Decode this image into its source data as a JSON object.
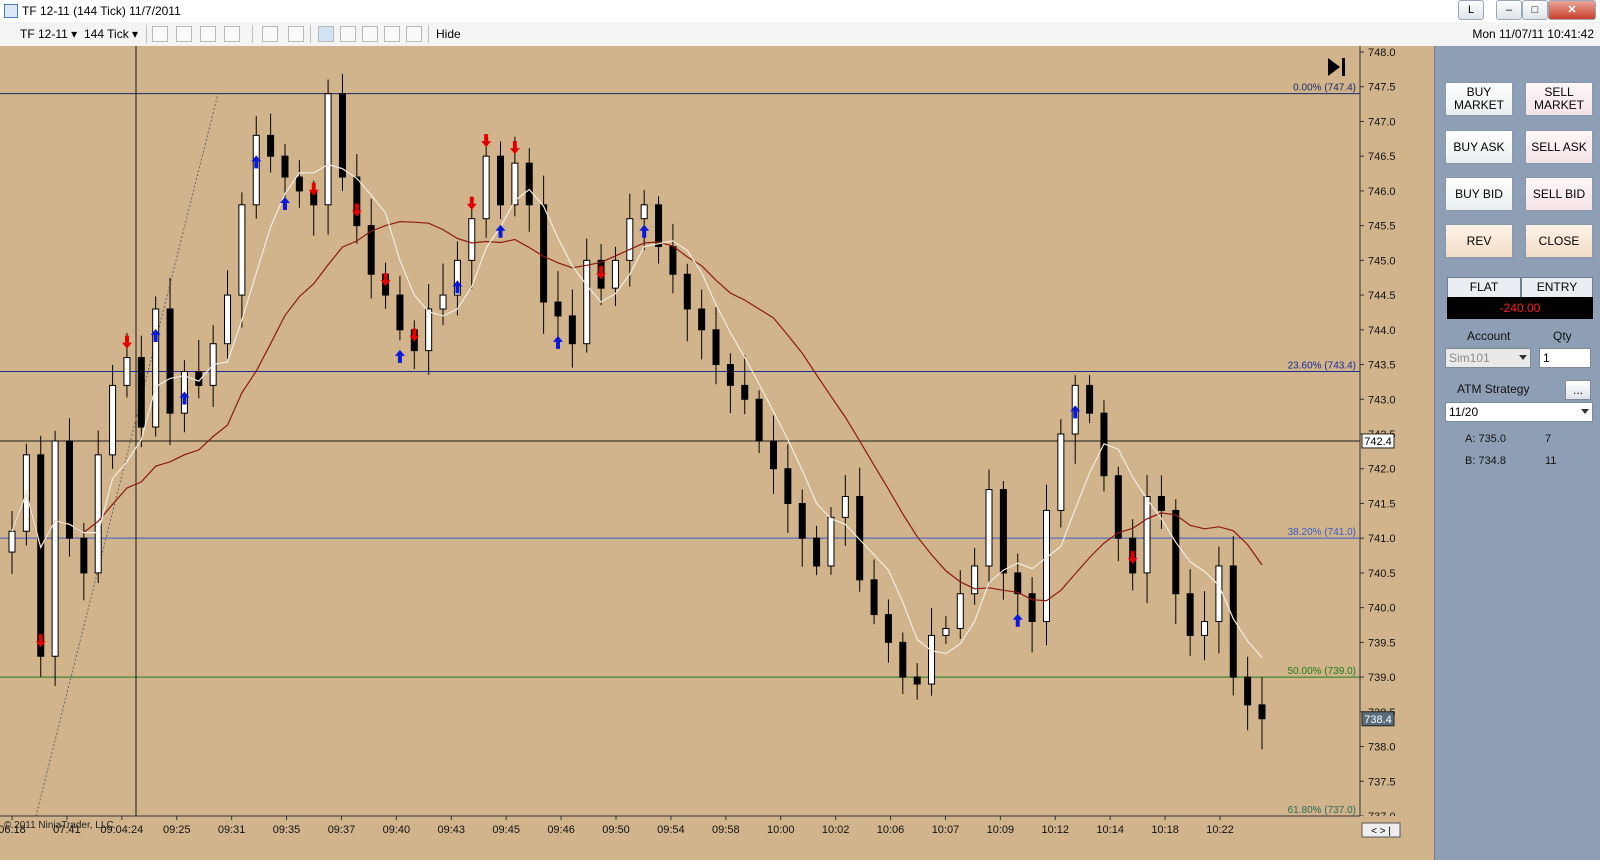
{
  "window": {
    "title": "TF 12-11 (144 Tick)  11/7/2011",
    "buttons": {
      "l": "L",
      "minimize": "–",
      "maximize": "□",
      "close": "✕"
    }
  },
  "toolbar": {
    "instrument": "TF 12-11",
    "interval": "144 Tick",
    "hide_label": "Hide",
    "datetime": "Mon 11/07/11 10:41:42",
    "icons": [
      "bar-type-icon",
      "draw-pencil-icon",
      "drawing-tools-icon",
      "strategy-icon",
      "crosshair-icon",
      "zoom-icon",
      "chart-trader-icon",
      "indicators-icon",
      "chart-properties-icon",
      "data-box-icon",
      "notes-icon"
    ]
  },
  "chart_data": {
    "type": "candlestick",
    "x_ticks": [
      "06:18",
      "07:41",
      "09:04:24",
      "09:25",
      "09:31",
      "09:35",
      "09:37",
      "09:40",
      "09:43",
      "09:45",
      "09:46",
      "09:50",
      "09:54",
      "09:58",
      "10:00",
      "10:02",
      "10:06",
      "10:07",
      "10:09",
      "10:12",
      "10:14",
      "10:18",
      "10:22"
    ],
    "y_ticks": [
      "748.0",
      "747.5",
      "747.0",
      "746.5",
      "746.0",
      "745.5",
      "745.0",
      "744.5",
      "744.0",
      "743.5",
      "743.0",
      "742.5",
      "742.0",
      "741.5",
      "741.0",
      "740.5",
      "740.0",
      "739.5",
      "739.0",
      "738.5",
      "738.0",
      "737.5",
      "737.0"
    ],
    "ylim": [
      737.0,
      748.0
    ],
    "last_price": "742.4",
    "current_price": "738.4",
    "fib_levels": [
      {
        "label": "0.00% (747.4)",
        "price": 747.4,
        "color": "#1a2a66"
      },
      {
        "label": "23.60% (743.4)",
        "price": 743.4,
        "color": "#1a2a99"
      },
      {
        "label": "38.20% (741.0)",
        "price": 741.0,
        "color": "#3a5ac8"
      },
      {
        "label": "50.00% (739.0)",
        "price": 739.0,
        "color": "#1d7a1d"
      },
      {
        "label": "61.80% (737.0)",
        "price": 737.0,
        "color": "#2a6a55"
      }
    ],
    "close_series": [
      741.1,
      742.2,
      739.3,
      742.4,
      741.0,
      740.5,
      742.2,
      743.2,
      743.6,
      742.6,
      744.3,
      742.8,
      743.4,
      743.2,
      743.8,
      744.5,
      745.8,
      746.8,
      746.5,
      746.2,
      746.0,
      745.8,
      747.4,
      746.2,
      745.5,
      744.8,
      744.5,
      744.0,
      743.7,
      744.3,
      744.5,
      745.0,
      745.6,
      746.5,
      745.8,
      746.4,
      745.8,
      744.4,
      744.2,
      743.8,
      745.0,
      744.6,
      745.0,
      745.6,
      745.8,
      745.2,
      744.8,
      744.3,
      744.0,
      743.5,
      743.2,
      743.0,
      742.4,
      742.0,
      741.5,
      741.0,
      740.6,
      741.3,
      741.6,
      740.4,
      739.9,
      739.5,
      739.0,
      738.9,
      739.6,
      739.7,
      740.2,
      740.6,
      741.7,
      740.5,
      740.2,
      739.8,
      741.4,
      742.5,
      743.2,
      742.8,
      741.9,
      741.0,
      740.5,
      741.6,
      741.4,
      740.2,
      739.6,
      739.8,
      740.6,
      739.0,
      738.6,
      738.4
    ],
    "annotations": {
      "sell_signals": 11,
      "buy_signals": 11
    }
  },
  "footer": {
    "copyright": "© 2011 NinjaTrader, LLC"
  },
  "panel": {
    "buttons": {
      "buy_market": "BUY\nMARKET",
      "sell_market": "SELL\nMARKET",
      "buy_ask": "BUY ASK",
      "sell_ask": "SELL ASK",
      "buy_bid": "BUY BID",
      "sell_bid": "SELL BID",
      "rev": "REV",
      "close": "CLOSE"
    },
    "position": "FLAT",
    "entry": "ENTRY",
    "pnl": "-240.00",
    "account_label": "Account",
    "qty_label": "Qty",
    "account": "Sim101",
    "qty": "1",
    "atm_label": "ATM Strategy",
    "atm_value": "11/20",
    "ask_label": "A: 735.0",
    "ask_size": "7",
    "bid_label": "B: 734.8",
    "bid_size": "11",
    "dots": "..."
  },
  "colors": {
    "chart_bg": "#d1b48c",
    "sma_fast": "#f3ede1",
    "sma_slow": "#8b1a10",
    "sell_arrow": "#e00000",
    "buy_arrow": "#0a1ad8",
    "pnl_text": "#ff1a1a"
  }
}
